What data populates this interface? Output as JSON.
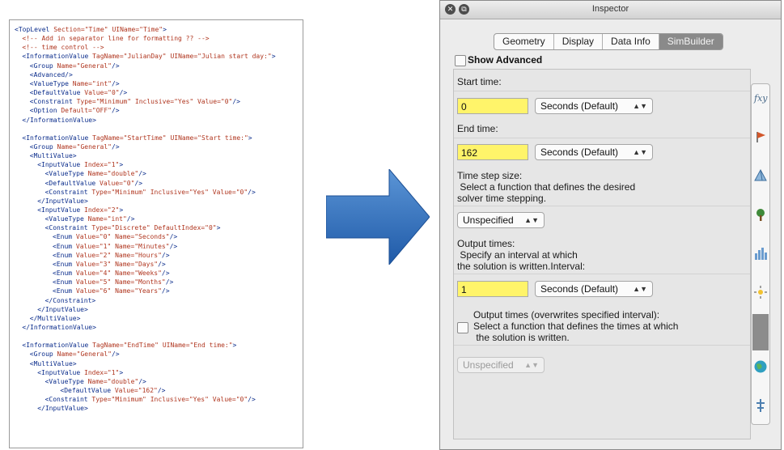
{
  "xml_lines": [
    {
      "indent": 0,
      "kind": "open",
      "tag": "TopLevel",
      "attrs": [
        [
          "Section",
          "Time"
        ],
        [
          "UIName",
          "Time"
        ]
      ]
    },
    {
      "indent": 1,
      "kind": "comment",
      "text": "<!-- Add in separator line for formatting ?? -->"
    },
    {
      "indent": 1,
      "kind": "comment",
      "text": "<!-- time control -->"
    },
    {
      "indent": 1,
      "kind": "open",
      "tag": "InformationValue",
      "attrs": [
        [
          "TagName",
          "JulianDay"
        ],
        [
          "UIName",
          "Julian start day:"
        ]
      ]
    },
    {
      "indent": 2,
      "kind": "self",
      "tag": "Group",
      "attrs": [
        [
          "Name",
          "General"
        ]
      ]
    },
    {
      "indent": 2,
      "kind": "self",
      "tag": "Advanced",
      "attrs": []
    },
    {
      "indent": 2,
      "kind": "self",
      "tag": "ValueType",
      "attrs": [
        [
          "Name",
          "int"
        ]
      ]
    },
    {
      "indent": 2,
      "kind": "self",
      "tag": "DefaultValue",
      "attrs": [
        [
          "Value",
          "0"
        ]
      ]
    },
    {
      "indent": 2,
      "kind": "self",
      "tag": "Constraint",
      "attrs": [
        [
          "Type",
          "Minimum"
        ],
        [
          "Inclusive",
          "Yes"
        ],
        [
          "Value",
          "0"
        ]
      ]
    },
    {
      "indent": 2,
      "kind": "self",
      "tag": "Option",
      "attrs": [
        [
          "Default",
          "OFF"
        ]
      ]
    },
    {
      "indent": 1,
      "kind": "close",
      "tag": "InformationValue"
    },
    {
      "indent": 0,
      "kind": "blank"
    },
    {
      "indent": 1,
      "kind": "open",
      "tag": "InformationValue",
      "attrs": [
        [
          "TagName",
          "StartTime"
        ],
        [
          "UIName",
          "Start time:"
        ]
      ]
    },
    {
      "indent": 2,
      "kind": "self",
      "tag": "Group",
      "attrs": [
        [
          "Name",
          "General"
        ]
      ]
    },
    {
      "indent": 2,
      "kind": "open",
      "tag": "MultiValue",
      "attrs": []
    },
    {
      "indent": 3,
      "kind": "open",
      "tag": "InputValue",
      "attrs": [
        [
          "Index",
          "1"
        ]
      ]
    },
    {
      "indent": 4,
      "kind": "self",
      "tag": "ValueType",
      "attrs": [
        [
          "Name",
          "double"
        ]
      ]
    },
    {
      "indent": 4,
      "kind": "self",
      "tag": "DefaultValue",
      "attrs": [
        [
          "Value",
          "0"
        ]
      ]
    },
    {
      "indent": 4,
      "kind": "self",
      "tag": "Constraint",
      "attrs": [
        [
          "Type",
          "Minimum"
        ],
        [
          "Inclusive",
          "Yes"
        ],
        [
          "Value",
          "0"
        ]
      ]
    },
    {
      "indent": 3,
      "kind": "close",
      "tag": "InputValue"
    },
    {
      "indent": 3,
      "kind": "open",
      "tag": "InputValue",
      "attrs": [
        [
          "Index",
          "2"
        ]
      ]
    },
    {
      "indent": 4,
      "kind": "self",
      "tag": "ValueType",
      "attrs": [
        [
          "Name",
          "int"
        ]
      ]
    },
    {
      "indent": 4,
      "kind": "open",
      "tag": "Constraint",
      "attrs": [
        [
          "Type",
          "Discrete"
        ],
        [
          "DefaultIndex",
          "0"
        ]
      ]
    },
    {
      "indent": 5,
      "kind": "self",
      "tag": "Enum",
      "attrs": [
        [
          "Value",
          "0"
        ],
        [
          "Name",
          "Seconds"
        ]
      ]
    },
    {
      "indent": 5,
      "kind": "self",
      "tag": "Enum",
      "attrs": [
        [
          "Value",
          "1"
        ],
        [
          "Name",
          "Minutes"
        ]
      ]
    },
    {
      "indent": 5,
      "kind": "self",
      "tag": "Enum",
      "attrs": [
        [
          "Value",
          "2"
        ],
        [
          "Name",
          "Hours"
        ]
      ]
    },
    {
      "indent": 5,
      "kind": "self",
      "tag": "Enum",
      "attrs": [
        [
          "Value",
          "3"
        ],
        [
          "Name",
          "Days"
        ]
      ]
    },
    {
      "indent": 5,
      "kind": "self",
      "tag": "Enum",
      "attrs": [
        [
          "Value",
          "4"
        ],
        [
          "Name",
          "Weeks"
        ]
      ]
    },
    {
      "indent": 5,
      "kind": "self",
      "tag": "Enum",
      "attrs": [
        [
          "Value",
          "5"
        ],
        [
          "Name",
          "Months"
        ]
      ]
    },
    {
      "indent": 5,
      "kind": "self",
      "tag": "Enum",
      "attrs": [
        [
          "Value",
          "6"
        ],
        [
          "Name",
          "Years"
        ]
      ]
    },
    {
      "indent": 4,
      "kind": "close",
      "tag": "Constraint"
    },
    {
      "indent": 3,
      "kind": "close",
      "tag": "InputValue"
    },
    {
      "indent": 2,
      "kind": "close",
      "tag": "MultiValue"
    },
    {
      "indent": 1,
      "kind": "close",
      "tag": "InformationValue"
    },
    {
      "indent": 0,
      "kind": "blank"
    },
    {
      "indent": 1,
      "kind": "open",
      "tag": "InformationValue",
      "attrs": [
        [
          "TagName",
          "EndTime"
        ],
        [
          "UIName",
          "End time:"
        ]
      ]
    },
    {
      "indent": 2,
      "kind": "self",
      "tag": "Group",
      "attrs": [
        [
          "Name",
          "General"
        ]
      ]
    },
    {
      "indent": 2,
      "kind": "open",
      "tag": "MultiValue",
      "attrs": []
    },
    {
      "indent": 3,
      "kind": "open",
      "tag": "InputValue",
      "attrs": [
        [
          "Index",
          "1"
        ]
      ]
    },
    {
      "indent": 4,
      "kind": "self",
      "tag": "ValueType",
      "attrs": [
        [
          "Name",
          "double"
        ]
      ]
    },
    {
      "indent": 6,
      "kind": "self",
      "tag": "DefaultValue",
      "attrs": [
        [
          "Value",
          "162"
        ]
      ]
    },
    {
      "indent": 4,
      "kind": "self",
      "tag": "Constraint",
      "attrs": [
        [
          "Type",
          "Minimum"
        ],
        [
          "Inclusive",
          "Yes"
        ],
        [
          "Value",
          "0"
        ]
      ]
    },
    {
      "indent": 3,
      "kind": "close",
      "tag": "InputValue"
    }
  ],
  "colors": {
    "tag": "#0b2d8c",
    "attr": "#b0361f",
    "arrow": "#2f6fbf",
    "field": "#fff46a",
    "active_tab": "#8a8a8a"
  },
  "inspector": {
    "title": "Inspector",
    "window_buttons": [
      "close-icon",
      "detach-icon"
    ],
    "tabs": [
      {
        "label": "Geometry",
        "active": false
      },
      {
        "label": "Display",
        "active": false
      },
      {
        "label": "Data Info",
        "active": false
      },
      {
        "label": "SimBuilder",
        "active": true
      }
    ],
    "show_advanced": {
      "label": "Show Advanced",
      "checked": false
    },
    "start_time": {
      "label": "Start time:",
      "value": "0",
      "unit": "Seconds (Default)"
    },
    "end_time": {
      "label": "End time:",
      "value": "162",
      "unit": "Seconds (Default)"
    },
    "time_step": {
      "label": "Time step size:",
      "description": " Select a function that defines the desired\nsolver time stepping.",
      "selected": "Unspecified"
    },
    "output_times": {
      "label": "Output times:",
      "description": " Specify an interval at which\nthe solution is written.Interval:",
      "value": "1",
      "unit": "Seconds (Default)"
    },
    "output_times_override": {
      "label": "Output times (overwrites specified interval):",
      "description": "Select a function that defines the times at which\n the solution is written.",
      "checked": false,
      "selected": "Unspecified"
    },
    "sidebar_icons": [
      "function-icon",
      "flag-marker-icon",
      "pyramid-icon",
      "tree-icon",
      "bar-chart-icon",
      "light-icon",
      "globe-icon",
      "sim-icon"
    ]
  }
}
